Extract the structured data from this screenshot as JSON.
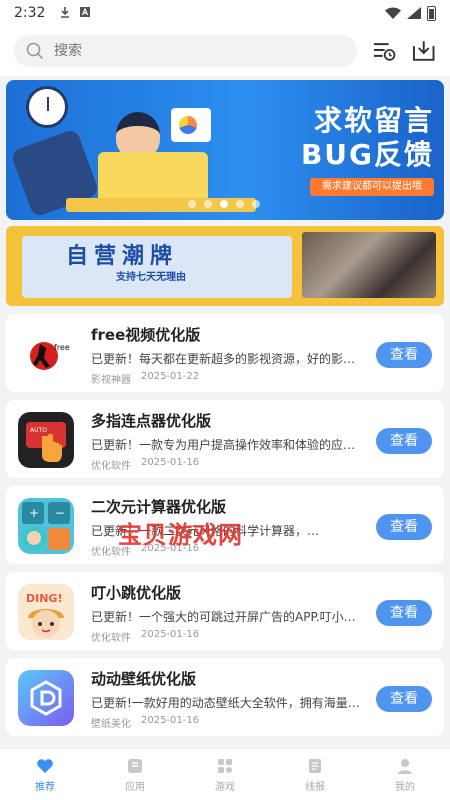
{
  "statusbar": {
    "time": "2:32"
  },
  "search": {
    "placeholder": "搜索"
  },
  "banner": {
    "title_line1": "求软留言",
    "title_line2": "BUG反馈",
    "subtitle": "需求建议都可以提出哦",
    "dots": 5,
    "active_dot": 3
  },
  "ad": {
    "title": "自营潮牌",
    "subtitle": "支持七天无理由"
  },
  "apps": [
    {
      "name": "free视频优化版",
      "desc": "已更新！每天都在更新超多的影视资源，好的影视…",
      "tag": "影视神器",
      "date": "2025-01-22",
      "button": "查看"
    },
    {
      "name": "多指连点器优化版",
      "desc": "已更新！一款专为用户提高操作效率和体验的应用…",
      "tag": "优化软件",
      "date": "2025-01-16",
      "button": "查看"
    },
    {
      "name": "二次元计算器优化版",
      "desc": "已更新！一款二次元风格的科学计算器，…",
      "tag": "优化软件",
      "date": "2025-01-16",
      "button": "查看"
    },
    {
      "name": "叮小跳优化版",
      "desc": "已更新！一个强大的可跳过开屏广告的APP.叮小跳…",
      "tag": "优化软件",
      "date": "2025-01-16",
      "button": "查看"
    },
    {
      "name": "动动壁纸优化版",
      "desc": "已更新!一款好用的动态壁纸大全软件，拥有海量…",
      "tag": "壁纸美化",
      "date": "2025-01-16",
      "button": "查看"
    }
  ],
  "watermark": "宝贝游戏网",
  "tabs": [
    {
      "label": "推荐",
      "icon": "heart-icon",
      "active": true
    },
    {
      "label": "应用",
      "icon": "app-icon",
      "active": false
    },
    {
      "label": "游戏",
      "icon": "grid-icon",
      "active": false
    },
    {
      "label": "线报",
      "icon": "document-icon",
      "active": false
    },
    {
      "label": "我的",
      "icon": "user-icon",
      "active": false
    }
  ],
  "colors": {
    "accent": "#3a8ef6",
    "button": "#4f95f0",
    "banner_blue": "#1d6fd6",
    "ad_yellow": "#f5c33b"
  }
}
